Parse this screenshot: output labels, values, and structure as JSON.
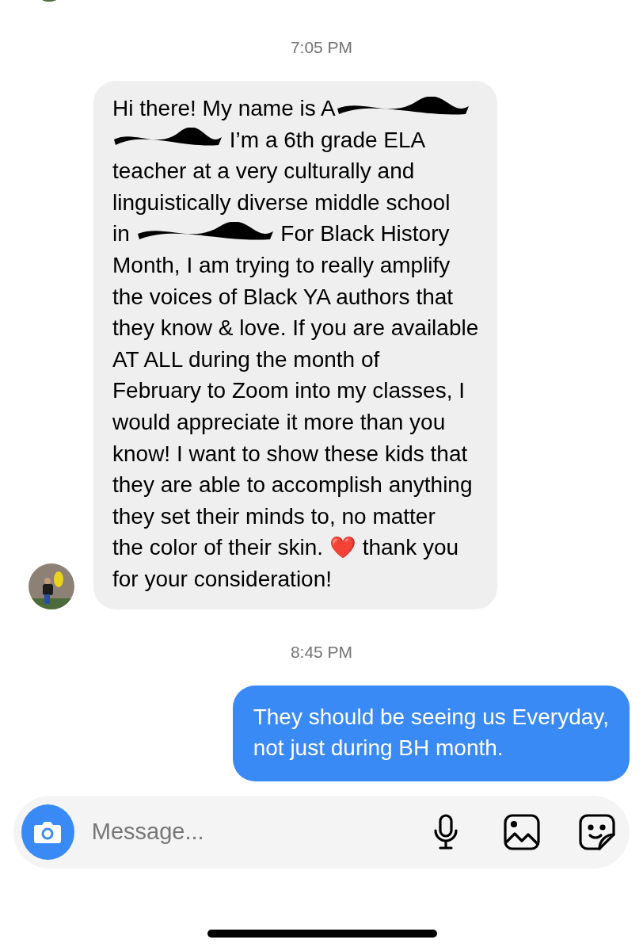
{
  "top_avatar": {
    "kind": "picture"
  },
  "thread": [
    {
      "kind": "timestamp",
      "text": "7:05 PM"
    },
    {
      "kind": "received",
      "avatar": {
        "kind": "picture"
      },
      "lines": [
        [
          {
            "kind": "text",
            "text": "Hi there! My name is A"
          },
          {
            "kind": "redaction"
          }
        ],
        [
          {
            "kind": "redaction"
          },
          {
            "kind": "text",
            "text": " I’m a 6th grade ELA"
          }
        ],
        [
          {
            "kind": "text",
            "text": "teacher at a very culturally and"
          }
        ],
        [
          {
            "kind": "text",
            "text": "linguistically diverse middle school"
          }
        ],
        [
          {
            "kind": "text",
            "text": "in "
          },
          {
            "kind": "redaction"
          },
          {
            "kind": "text",
            "text": " For Black History"
          }
        ],
        [
          {
            "kind": "text",
            "text": "Month, I am trying to really amplify"
          }
        ],
        [
          {
            "kind": "text",
            "text": "the voices of Black YA authors that"
          }
        ],
        [
          {
            "kind": "text",
            "text": "they know & love. If you are available"
          }
        ],
        [
          {
            "kind": "text",
            "text": "AT ALL during the month of"
          }
        ],
        [
          {
            "kind": "text",
            "text": "February to Zoom into my classes, I"
          }
        ],
        [
          {
            "kind": "text",
            "text": "would appreciate it more than you"
          }
        ],
        [
          {
            "kind": "text",
            "text": "know! I want to show these kids that"
          }
        ],
        [
          {
            "kind": "text",
            "text": "they are able to accomplish anything"
          }
        ],
        [
          {
            "kind": "text",
            "text": "they set their minds to, no matter"
          }
        ],
        [
          {
            "kind": "text",
            "text": "the color of their skin. "
          },
          {
            "kind": "emoji",
            "text": "❤️"
          },
          {
            "kind": "text",
            "text": " thank you"
          }
        ],
        [
          {
            "kind": "text",
            "text": "for your consideration!"
          }
        ]
      ]
    },
    {
      "kind": "timestamp",
      "text": "8:45 PM"
    },
    {
      "kind": "sent",
      "lines": [
        [
          {
            "kind": "text",
            "text": "They should be seeing us Everyday,"
          }
        ],
        [
          {
            "kind": "text",
            "text": "not just during BH month."
          }
        ]
      ]
    }
  ],
  "composer": {
    "placeholder": "Message..."
  }
}
